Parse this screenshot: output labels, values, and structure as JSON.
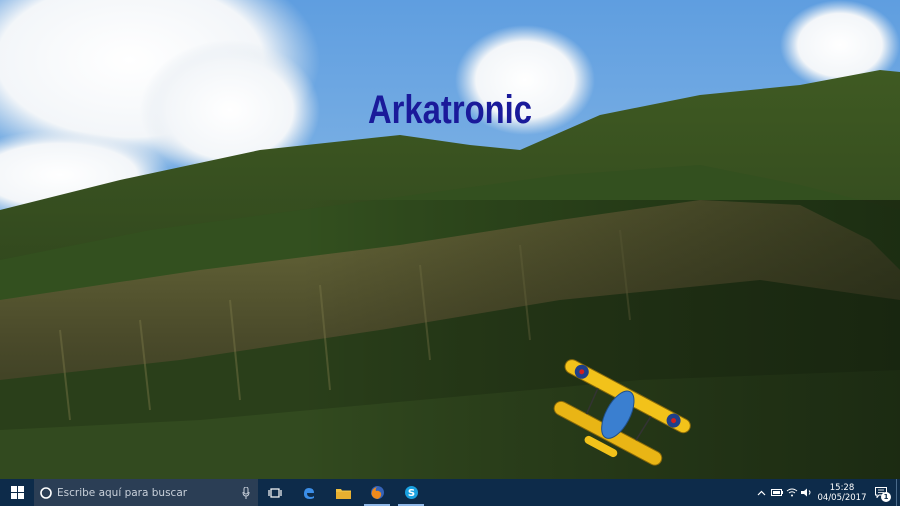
{
  "desktop": {
    "watermark_text": "Arkatronic",
    "colors": {
      "watermark": "#1a1a9a",
      "taskbar": "#0d2b4a",
      "search_box": "#2b3e55"
    }
  },
  "taskbar": {
    "start_icon": "windows-logo-icon",
    "search": {
      "placeholder": "Escribe aquí para buscar",
      "mic_icon": "microphone-icon"
    },
    "pinned_apps": [
      {
        "name": "task-view",
        "icon": "task-view-icon"
      },
      {
        "name": "edge",
        "icon": "edge-icon"
      },
      {
        "name": "file-explorer",
        "icon": "folder-icon"
      },
      {
        "name": "firefox",
        "icon": "firefox-icon"
      },
      {
        "name": "skype",
        "icon": "skype-icon"
      }
    ],
    "tray": {
      "icons": [
        "chevron-up-icon",
        "battery-icon",
        "wifi-icon",
        "volume-icon"
      ],
      "time": "15:28",
      "date": "04/05/2017",
      "notification_count": "1"
    }
  }
}
